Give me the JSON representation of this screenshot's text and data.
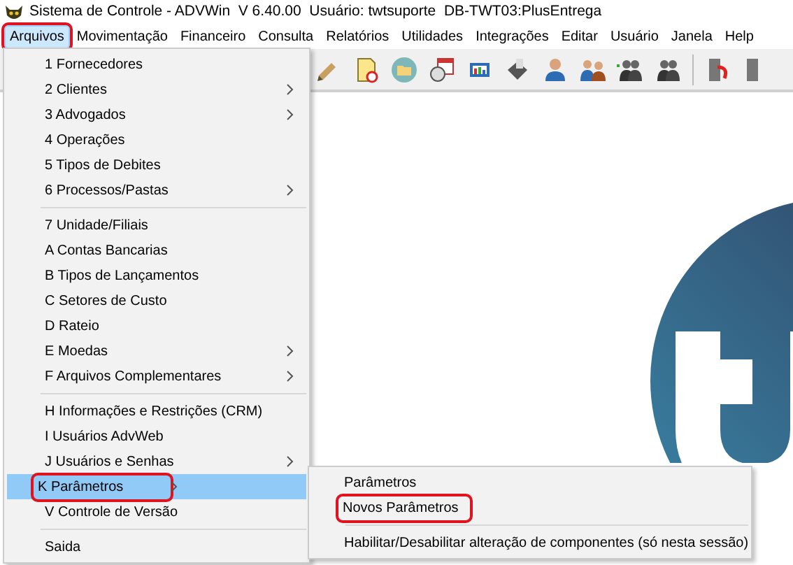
{
  "window": {
    "title": "Sistema de Controle - ADVWin  V 6.40.00  Usuário: twtsuporte  DB-TWT03:PlusEntrega"
  },
  "menubar": [
    {
      "label": "Arquivos",
      "selected": true,
      "annotated": true
    },
    {
      "label": "Movimentação",
      "selected": false,
      "annotated": false
    },
    {
      "label": "Financeiro",
      "selected": false,
      "annotated": false
    },
    {
      "label": "Consulta",
      "selected": false,
      "annotated": false
    },
    {
      "label": "Relatórios",
      "selected": false,
      "annotated": false
    },
    {
      "label": "Utilidades",
      "selected": false,
      "annotated": false
    },
    {
      "label": "Integrações",
      "selected": false,
      "annotated": false
    },
    {
      "label": "Editar",
      "selected": false,
      "annotated": false
    },
    {
      "label": "Usuário",
      "selected": false,
      "annotated": false
    },
    {
      "label": "Janela",
      "selected": false,
      "annotated": false
    },
    {
      "label": "Help",
      "selected": false,
      "annotated": false
    }
  ],
  "menu": [
    [
      {
        "label": "1 Fornecedores",
        "submenu": false,
        "selected": false,
        "annotated": false
      },
      {
        "label": "2 Clientes",
        "submenu": true,
        "selected": false,
        "annotated": false
      },
      {
        "label": "3 Advogados",
        "submenu": true,
        "selected": false,
        "annotated": false
      },
      {
        "label": "4 Operações",
        "submenu": false,
        "selected": false,
        "annotated": false
      },
      {
        "label": "5 Tipos de Debites",
        "submenu": false,
        "selected": false,
        "annotated": false
      },
      {
        "label": "6 Processos/Pastas",
        "submenu": true,
        "selected": false,
        "annotated": false
      }
    ],
    [
      {
        "label": "7 Unidade/Filiais",
        "submenu": false,
        "selected": false,
        "annotated": false
      },
      {
        "label": "A Contas Bancarias",
        "submenu": false,
        "selected": false,
        "annotated": false
      },
      {
        "label": "B Tipos de Lançamentos",
        "submenu": false,
        "selected": false,
        "annotated": false
      },
      {
        "label": "C Setores de Custo",
        "submenu": false,
        "selected": false,
        "annotated": false
      },
      {
        "label": "D Rateio",
        "submenu": false,
        "selected": false,
        "annotated": false
      },
      {
        "label": "E Moedas",
        "submenu": true,
        "selected": false,
        "annotated": false
      },
      {
        "label": "F Arquivos Complementares",
        "submenu": true,
        "selected": false,
        "annotated": false
      }
    ],
    [
      {
        "label": "H Informações e Restrições (CRM)",
        "submenu": false,
        "selected": false,
        "annotated": false
      },
      {
        "label": "I Usuários AdvWeb",
        "submenu": false,
        "selected": false,
        "annotated": false
      },
      {
        "label": "J Usuários e Senhas",
        "submenu": true,
        "selected": false,
        "annotated": false
      },
      {
        "label": "K Parâmetros",
        "submenu": true,
        "selected": true,
        "annotated": true
      },
      {
        "label": "V Controle de Versão",
        "submenu": false,
        "selected": false,
        "annotated": false
      }
    ],
    [
      {
        "label": "Saida",
        "submenu": false,
        "selected": false,
        "annotated": false
      }
    ]
  ],
  "submenu": [
    [
      {
        "label": "Parâmetros",
        "annotated": false
      },
      {
        "label": "Novos Parâmetros",
        "annotated": true
      }
    ],
    [
      {
        "label": "Habilitar/Desabilitar alteração de componentes (só nesta sessão)",
        "annotated": false
      }
    ]
  ]
}
